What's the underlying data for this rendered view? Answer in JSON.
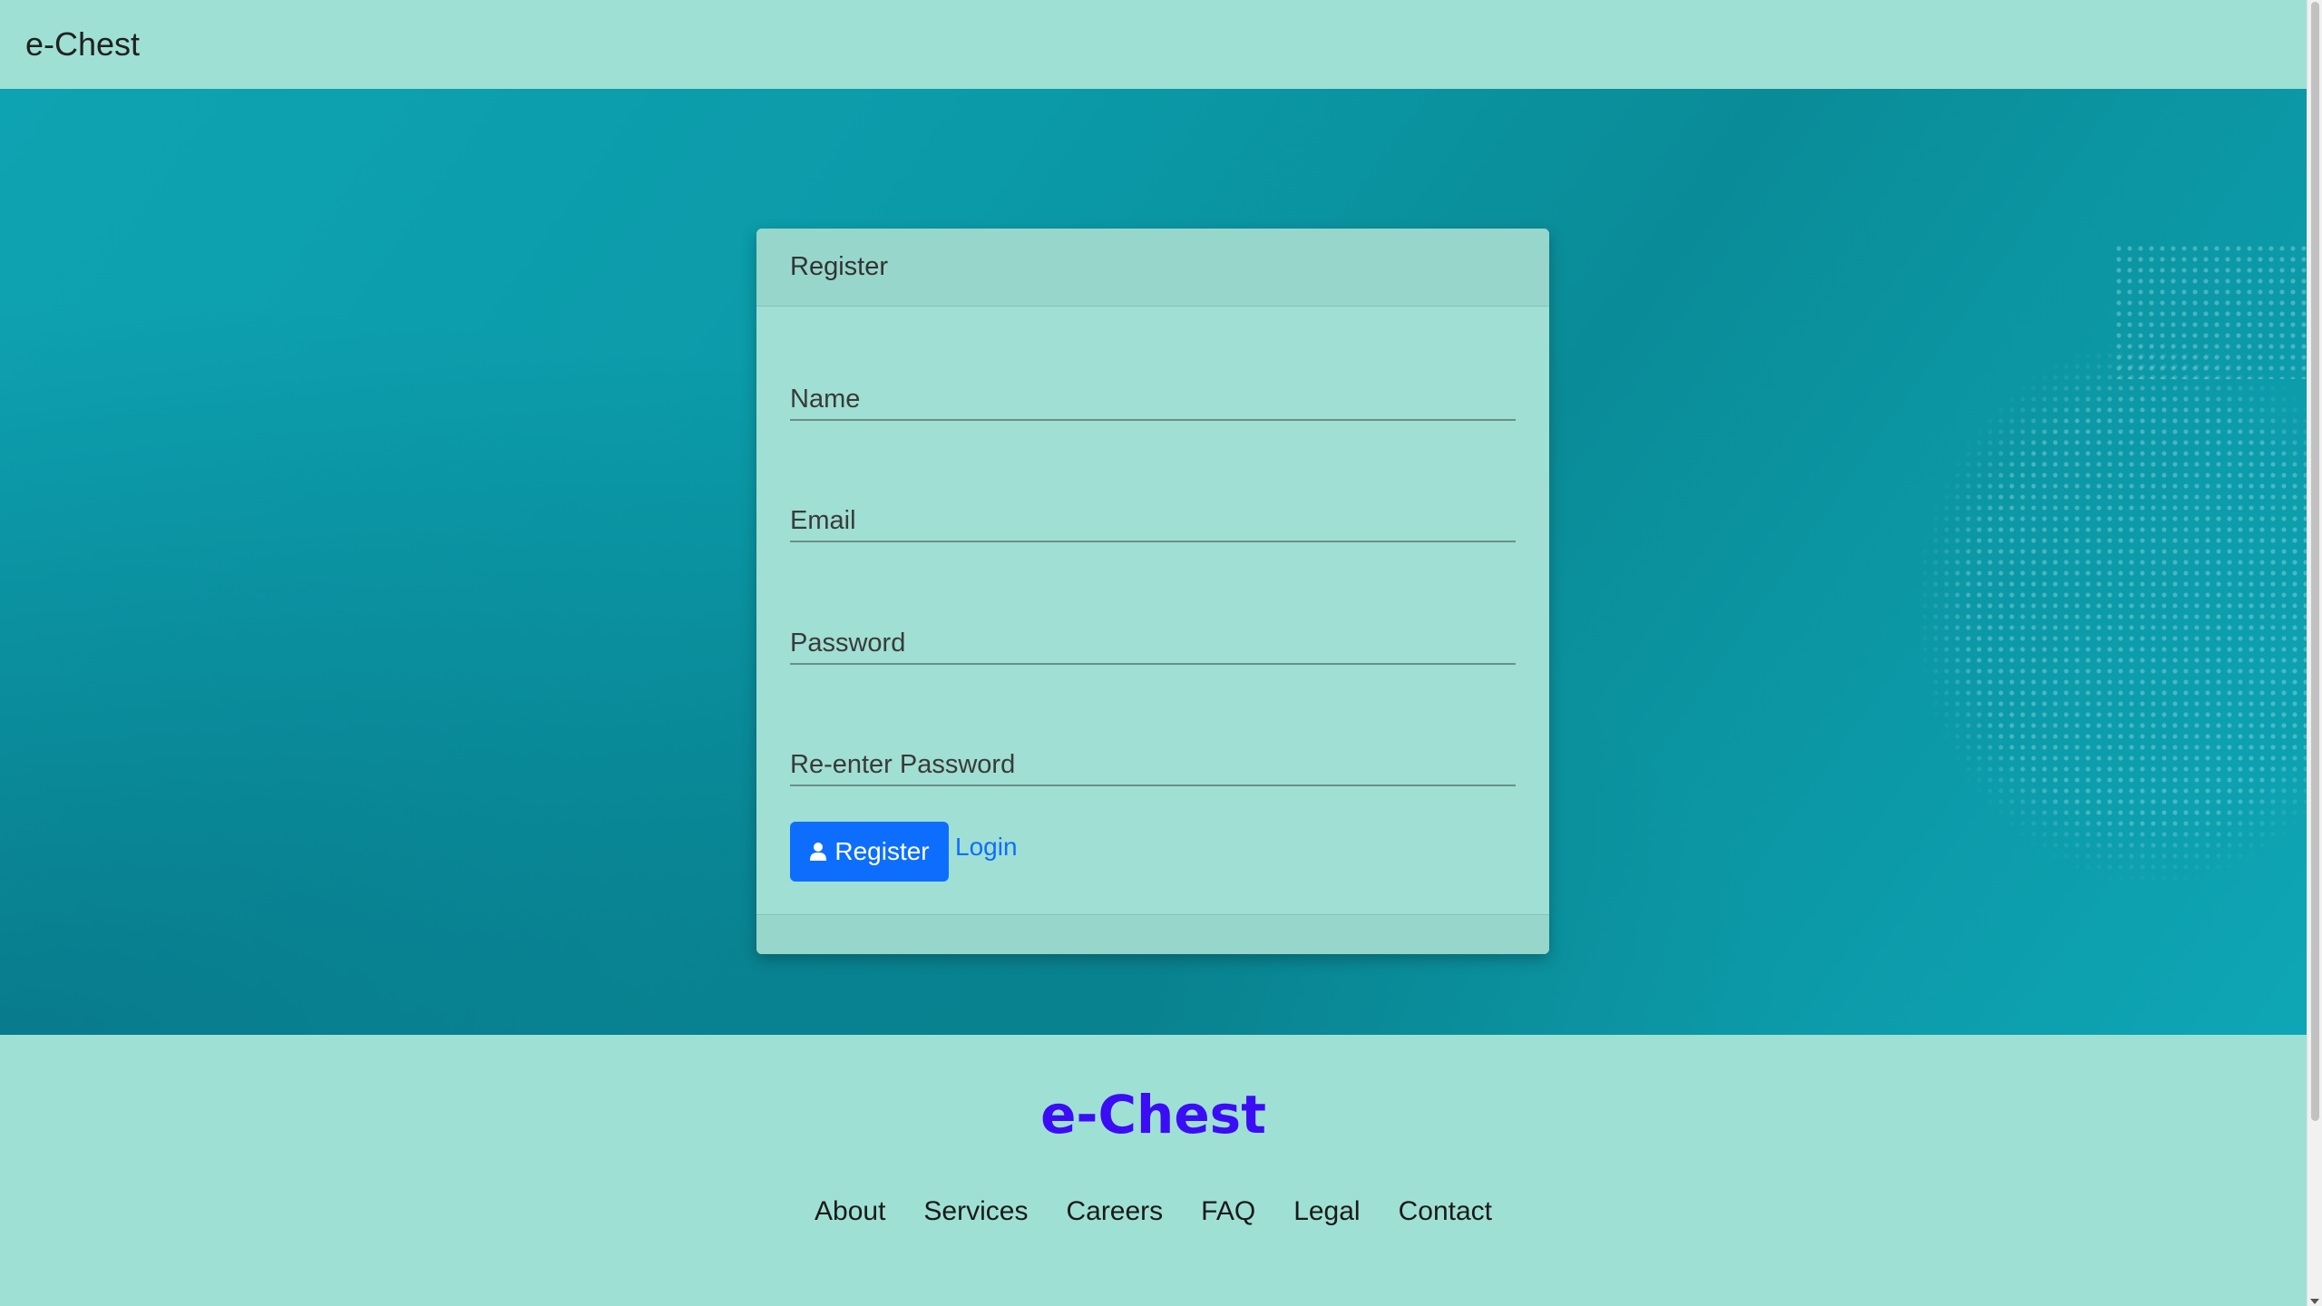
{
  "navbar": {
    "brand": "e-Chest"
  },
  "register_card": {
    "title": "Register",
    "fields": {
      "name_placeholder": "Name",
      "email_placeholder": "Email",
      "password_placeholder": "Password",
      "reenter_password_placeholder": "Re-enter Password"
    },
    "register_button_label": "Register",
    "login_link_label": "Login",
    "icons": {
      "register_button_icon": "user-icon"
    }
  },
  "footer": {
    "brand": "e-Chest",
    "links": [
      "About",
      "Services",
      "Careers",
      "FAQ",
      "Legal",
      "Contact"
    ]
  },
  "colors": {
    "primary": "#0d6efd",
    "footer_brand": "#3b0df5",
    "mint": "#9fe0d4",
    "hero_teal": "#0b9aa8"
  }
}
